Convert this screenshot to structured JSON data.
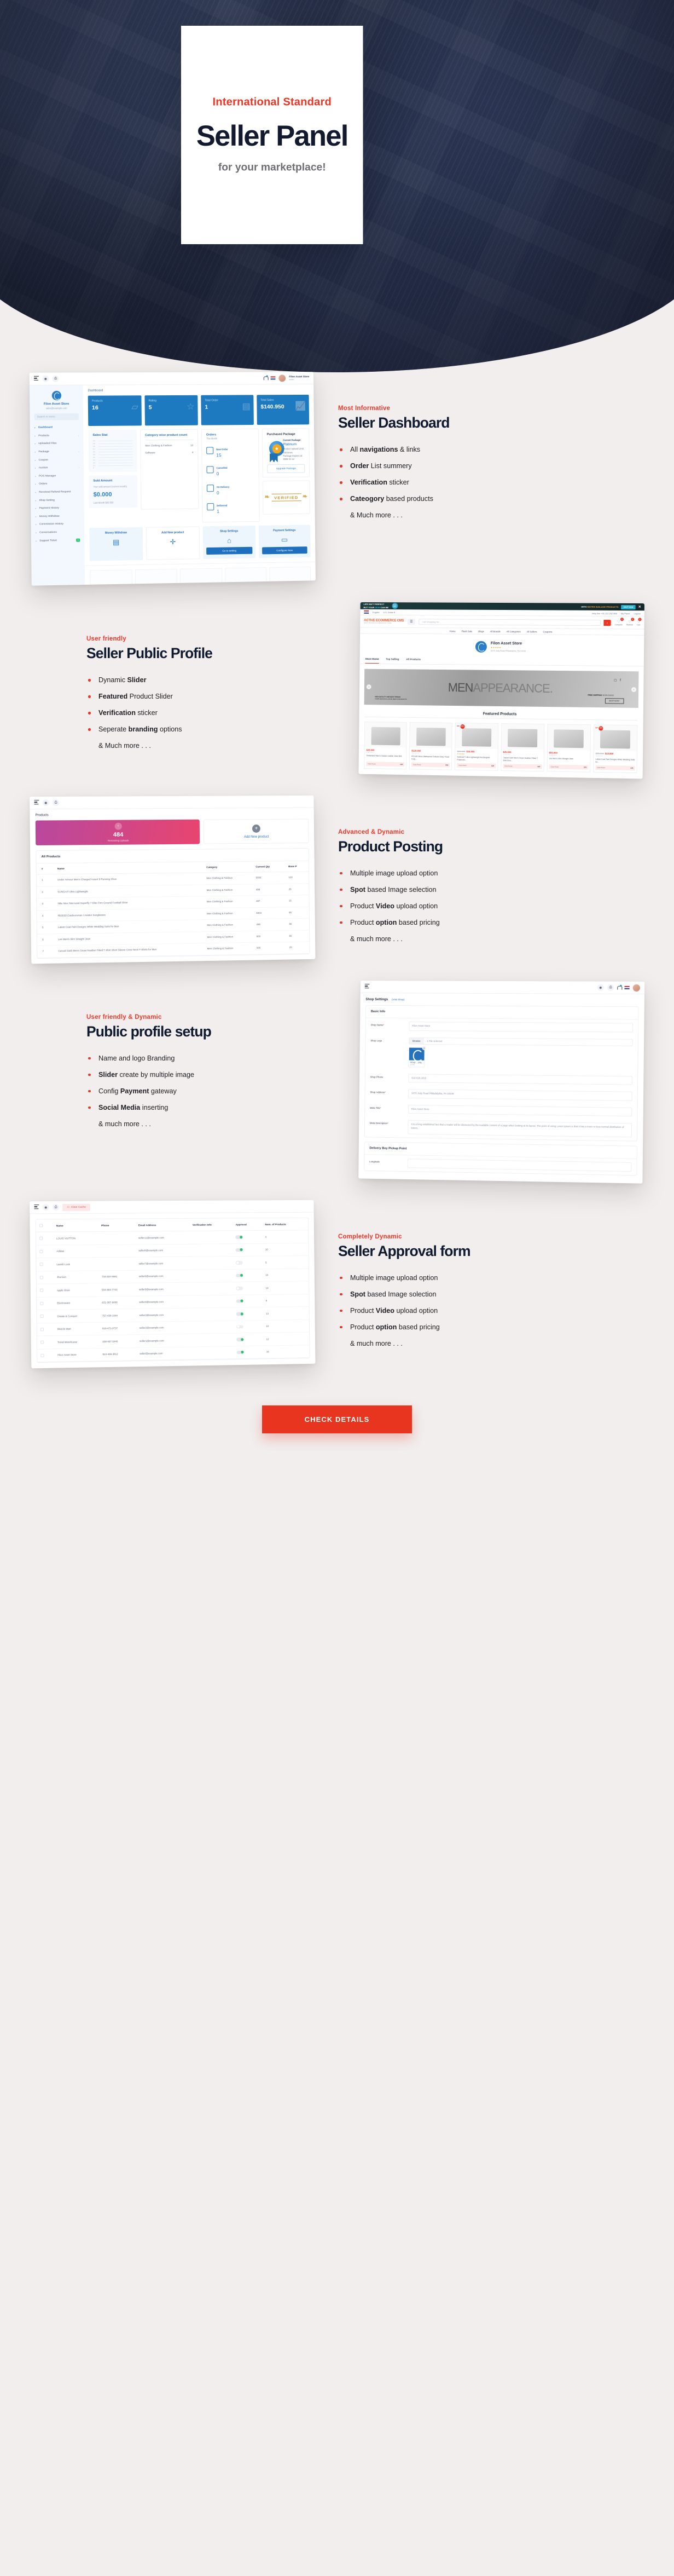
{
  "hero": {
    "eyebrow": "International Standard",
    "title": "Seller Panel",
    "subtitle": "for your marketplace!"
  },
  "sections": [
    {
      "eyebrow": "Most Informative",
      "title": "Seller Dashboard",
      "features": [
        {
          "pre": "All ",
          "bold": "navigations",
          "post": " & links"
        },
        {
          "pre": "",
          "bold": "Order",
          "post": " List summery"
        },
        {
          "pre": "",
          "bold": "Verification",
          "post": " sticker"
        },
        {
          "pre": "",
          "bold": "Cateogory",
          "post": " based products"
        }
      ],
      "more": "& Much more . . ."
    },
    {
      "eyebrow": "User friendly",
      "title": "Seller Public Profile",
      "features": [
        {
          "pre": "Dynamic ",
          "bold": "Slider",
          "post": ""
        },
        {
          "pre": "",
          "bold": "Featured",
          "post": " Product Slider"
        },
        {
          "pre": "",
          "bold": "Verification",
          "post": " sticker"
        },
        {
          "pre": "Seperate ",
          "bold": "branding",
          "post": " options"
        }
      ],
      "more": "& Much more . . ."
    },
    {
      "eyebrow": "Advanced & Dynamic",
      "title": "Product Posting",
      "features": [
        {
          "pre": "Multiple image upload option",
          "bold": "",
          "post": ""
        },
        {
          "pre": "",
          "bold": "Spot",
          "post": " based Image selection"
        },
        {
          "pre": "Product ",
          "bold": "Video",
          "post": " upload option"
        },
        {
          "pre": "Product ",
          "bold": "option",
          "post": " based pricing"
        }
      ],
      "more": "& much more . . ."
    },
    {
      "eyebrow": "User friendly & Dynamic",
      "title": "Public profile setup",
      "features": [
        {
          "pre": "Name and logo Branding",
          "bold": "",
          "post": ""
        },
        {
          "pre": "",
          "bold": "Slider",
          "post": " create by multiple image"
        },
        {
          "pre": "Config ",
          "bold": "Payment",
          "post": " gateway"
        },
        {
          "pre": "",
          "bold": "Social Media",
          "post": " inserting"
        }
      ],
      "more": "& much more . . ."
    },
    {
      "eyebrow": "Completely Dynamic",
      "title": "Seller Approval form",
      "features": [
        {
          "pre": "Multiple image upload option",
          "bold": "",
          "post": ""
        },
        {
          "pre": "",
          "bold": "Spot",
          "post": " based Image solection"
        },
        {
          "pre": "Product ",
          "bold": "Video",
          "post": " upload option"
        },
        {
          "pre": "Product ",
          "bold": "option",
          "post": " based pricing"
        }
      ],
      "more": "& much more . . ."
    }
  ],
  "dashboard": {
    "store_name": "Filon Asset Store",
    "store_email": "sales@example.com",
    "search_placeholder": "Search in menu",
    "topbar_user": "Filon Asset Store",
    "topbar_role": "seller",
    "breadcrumb": "Dashboard",
    "menu": [
      {
        "label": "Dashboard",
        "icon": "home-icon",
        "caret": false,
        "badge": ""
      },
      {
        "label": "Products",
        "icon": "box-icon",
        "caret": true,
        "badge": ""
      },
      {
        "label": "Uploaded Files",
        "icon": "file-icon",
        "caret": false,
        "badge": ""
      },
      {
        "label": "Package",
        "icon": "package-icon",
        "caret": true,
        "badge": ""
      },
      {
        "label": "Coupon",
        "icon": "coupon-icon",
        "caret": false,
        "badge": ""
      },
      {
        "label": "Auction",
        "icon": "gavel-icon",
        "caret": true,
        "badge": ""
      },
      {
        "label": "POS Manager",
        "icon": "pos-icon",
        "caret": false,
        "badge": ""
      },
      {
        "label": "Orders",
        "icon": "orders-icon",
        "caret": false,
        "badge": ""
      },
      {
        "label": "Received Refund Request",
        "icon": "refund-icon",
        "caret": false,
        "badge": ""
      },
      {
        "label": "Shop Setting",
        "icon": "gear-icon",
        "caret": false,
        "badge": ""
      },
      {
        "label": "Payment History",
        "icon": "clock-icon",
        "caret": false,
        "badge": ""
      },
      {
        "label": "Money Withdraw",
        "icon": "wallet-icon",
        "caret": false,
        "badge": ""
      },
      {
        "label": "Commission History",
        "icon": "percent-icon",
        "caret": false,
        "badge": ""
      },
      {
        "label": "Conversations",
        "icon": "chat-icon",
        "caret": false,
        "badge": ""
      },
      {
        "label": "Support Ticket",
        "icon": "ticket-icon",
        "caret": false,
        "badge": "0"
      }
    ],
    "kpis": [
      {
        "label": "Products",
        "value": "16",
        "icon": "box-icon"
      },
      {
        "label": "Rating",
        "value": "5",
        "icon": "star-icon"
      },
      {
        "label": "Total Order",
        "value": "1",
        "icon": "clipboard-icon"
      },
      {
        "label": "Total Sales",
        "value": "$140.950",
        "icon": "trend-icon"
      }
    ],
    "sales_stat_title": "Sales Stat",
    "sold_amount_title": "Sold Amount",
    "sold_amount_sub": "Your sold amount (current month)",
    "sold_amount_value": "$0.000",
    "sold_amount_last": "Last Month $80.950",
    "category_title": "Category wise product count",
    "categories": [
      {
        "name": "Men Clothing & Fashion",
        "count": "12"
      },
      {
        "name": "Software",
        "count": "4"
      }
    ],
    "orders_title": "Orders",
    "orders_sub": "This Month",
    "orders": [
      {
        "label": "New Order",
        "value": "15",
        "icon": "bag-icon"
      },
      {
        "label": "Cancelled",
        "value": "0",
        "icon": "cancel-icon"
      },
      {
        "label": "On Delivery",
        "value": "0",
        "icon": "delivery-icon"
      },
      {
        "label": "Delivered",
        "value": "1",
        "icon": "delivered-icon"
      }
    ],
    "package_title": "Purchased Package",
    "package_current_label": "Current Package:",
    "package_name": "Platinum",
    "package_limit": "Product Upload Limit: 500 times",
    "package_expire": "Package Expires at: 9999-31-12",
    "package_upgrade": "Upgrade Package",
    "verified_label": "VERIFIED",
    "actions": [
      {
        "title": "Money Withdraw",
        "button": "",
        "icon": "withdraw-icon"
      },
      {
        "title": "Add New product",
        "button": "",
        "icon": "plus-icon"
      },
      {
        "title": "Shop Settings",
        "button": "Go to setting",
        "icon": "shop-icon"
      },
      {
        "title": "Payment Settings",
        "button": "Configure Now",
        "icon": "card-icon"
      }
    ]
  },
  "storefront": {
    "promo_line1": "LIFE ISN'T PERFECT",
    "promo_line2_a": "BUT YOUR ",
    "promo_line2_b": "SKIN",
    "promo_line2_c": " CAN BE",
    "promo_badge": "50% OFF",
    "promo_right_a": "WITH ",
    "promo_right_b": "MATRIX BAILAGE PRODUCTS",
    "promo_shop": "SHOP NOW",
    "util_language": "English",
    "util_currency": "U.S. Dollar $",
    "util_helpline": "Help line +01 112 252 566",
    "util_panel": "My Panel",
    "util_logout": "Logout",
    "brand": "ACTIVE ECOMMERCE CMS",
    "brand_sub": "BEST RATED ECOMMERCE ITEM",
    "search_placeholder": "I am shopping for...",
    "mini": [
      {
        "label": "Compare",
        "count": "0"
      },
      {
        "label": "Wishlist",
        "count": "0"
      },
      {
        "label": "Cart",
        "count": "0"
      }
    ],
    "nav": [
      "Home",
      "Flash Sale",
      "Blogs",
      "All Brands",
      "All Categories",
      "All Sellers",
      "Coupons"
    ],
    "seller_name": "Filon Asset Store",
    "seller_stars": "★★★★★",
    "seller_address": "3475 Jody Road Philadelphia, PA 19108",
    "tabs": [
      "Store Home",
      "Top Selling",
      "All Products"
    ],
    "slide_word_a": "MEN",
    "slide_word_b": "APPEARANCE.",
    "slide_sub1": "HIGH QUALITY AND BEST PRICES",
    "slide_sub2": "OVER 5000 EXCLUSIVE MEN'S PRODUCTS",
    "slide_ship_a": "FREE SHIPPING",
    "slide_ship_b": " WORLDWIDE",
    "slide_shop": "SHOP NOW ›",
    "featured_title": "Featured Products",
    "products": [
      {
        "price": "$25.000",
        "old": "",
        "off": "",
        "name": "Timberland Men's Classic Leather Jean Belt",
        "club": "Club Point:",
        "points": "125",
        "rated": false
      },
      {
        "price": "$110.000",
        "old": "",
        "off": "",
        "name": "POLAR Mens Waterproof Outsole Deep Tread Fully...",
        "club": "Club Point:",
        "points": "550",
        "rated": false
      },
      {
        "price": "$14.000",
        "old": "$25.000",
        "off": "44%",
        "name": "SUNGAIT Ultra Lightweight Rectangular Polarized...",
        "club": "Club Point:",
        "points": "125",
        "rated": true
      },
      {
        "price": "$25.000",
        "old": "",
        "off": "",
        "name": "Casual Garb Men's Snow Heather Fitted T Shirt Shor...",
        "club": "Club Point:",
        "points": "125",
        "rated": false
      },
      {
        "price": "$55.000",
        "old": "",
        "off": "",
        "name": "Lee Men's Slim Straight Jean",
        "club": "Club Point:",
        "points": "275",
        "rated": false
      },
      {
        "price": "$23.800",
        "old": "$35.000",
        "off": "32%",
        "name": "Latest Coat Pant Designs White Wedding Suits for...",
        "club": "Club Point:",
        "points": "175",
        "rated": false
      }
    ]
  },
  "products_page": {
    "breadcrumb": "Products",
    "remaining_count": "484",
    "remaining_label": "Remaining Uploads",
    "add_label": "Add New product",
    "table_title": "All Products",
    "columns": [
      "#",
      "Name",
      "Category",
      "Current Qty",
      "Base P"
    ],
    "rows": [
      [
        "1",
        "Under Armour Men's Charged Assert 9 Running Shoe",
        "Men Clothing & Fashion",
        "5006",
        "120"
      ],
      [
        "2",
        "SUNGAIT Ultra Lightweight",
        "Men Clothing & Fashion",
        "498",
        "25"
      ],
      [
        "3",
        "Nike Men 'Mercurial Superfly 7 Elite Firm Ground Football Shoe",
        "Men Clothing & Fashion",
        "497",
        "15"
      ],
      [
        "4",
        "Rb3030 Outdoorsman I Aviator Sunglasses",
        "Men Clothing & Fashion",
        "5004",
        "95"
      ],
      [
        "5",
        "Latest Coat Pant Designs White Wedding Suits for Men",
        "Men Clothing & Fashion",
        "498",
        "35"
      ],
      [
        "6",
        "Lee Men's Slim Straight Jean",
        "Men Clothing & Fashion",
        "500",
        "55"
      ],
      [
        "7",
        "Casual Garb Men's Snow Heather Fitted T Shirt Short Sleeve Crew Neck T-Shirts for Men",
        "Men Clothing & Fashion",
        "500",
        "25"
      ]
    ]
  },
  "shop_settings": {
    "title": "Shop Settings",
    "visit_link": "(Visit Shop)",
    "basic_info": "Basic Info",
    "fields": [
      {
        "label": "Shop Name",
        "required": true,
        "value": "Filon Asset Store",
        "type": "text"
      },
      {
        "label": "Shop Logo",
        "required": false,
        "value": "1 File selected",
        "type": "file",
        "browse": "Browse",
        "file_name": "Group ....png",
        "file_size": "10 KB"
      },
      {
        "label": "Shop Phone",
        "required": false,
        "value": "610-528-1815",
        "type": "text"
      },
      {
        "label": "Shop Address",
        "required": true,
        "value": "3475 Jody Road Philadelphia, PA 19108",
        "type": "text"
      },
      {
        "label": "Meta Title",
        "required": true,
        "value": "Filon Asset Store",
        "type": "text"
      },
      {
        "label": "Meta Description",
        "required": true,
        "value": "It is a long established fact that a reader will be distracted by the readable content of a page when looking at its layout. The point of using Lorem Ipsum is that it has a more-or-less normal distribution of letters,",
        "type": "area"
      }
    ],
    "pickup_title": "Delivery Boy Pickup Point",
    "pickup_field": "Longitude"
  },
  "sellers_page": {
    "clear_cache": "Clear Cache",
    "columns": [
      "",
      "Name",
      "Phone",
      "Email Address",
      "Verification Info",
      "Approval",
      "Num. of Products"
    ],
    "rows": [
      {
        "name": "LOUIS VUITTON",
        "phone": "",
        "email": "seller11@example.com",
        "verification": "",
        "approved": true,
        "products": "4"
      },
      {
        "name": "Adidas",
        "phone": "",
        "email": "seller8@example.com",
        "verification": "",
        "approved": true,
        "products": "10"
      },
      {
        "name": "Lavish Look",
        "phone": "",
        "email": "seller7@example.com",
        "verification": "",
        "approved": false,
        "products": "5"
      },
      {
        "name": "Jhonson",
        "phone": "734-604-6681",
        "email": "seller6@example.com",
        "verification": "",
        "approved": true,
        "products": "10"
      },
      {
        "name": "Apple Store",
        "phone": "504-864-7743",
        "email": "seller5@example.com",
        "verification": "",
        "approved": false,
        "products": "13"
      },
      {
        "name": "Electroware",
        "phone": "631-387-9055",
        "email": "seller4@example.com",
        "verification": "",
        "approved": true,
        "products": "5"
      },
      {
        "name": "Create & Conquer",
        "phone": "757-438-1644",
        "email": "seller3@example.com",
        "verification": "",
        "approved": true,
        "products": "13"
      },
      {
        "name": "Muscle Mart",
        "phone": "816-471-0737",
        "email": "seller2@example.com",
        "verification": "",
        "approved": false,
        "products": "10"
      },
      {
        "name": "Trend Warehouse",
        "phone": "208-487-5446",
        "email": "seller1@example.com",
        "verification": "",
        "approved": true,
        "products": "12"
      },
      {
        "name": "Filon Asset Store",
        "phone": "913-469-3812",
        "email": "seller@example.com",
        "verification": "",
        "approved": true,
        "products": "16"
      }
    ]
  },
  "cta": {
    "label": "CHECK DETAILS"
  },
  "colors": {
    "accent": "#ee3524",
    "dark": "#101a2e",
    "blue": "#1e7ac0",
    "bg": "#f1eeed"
  }
}
